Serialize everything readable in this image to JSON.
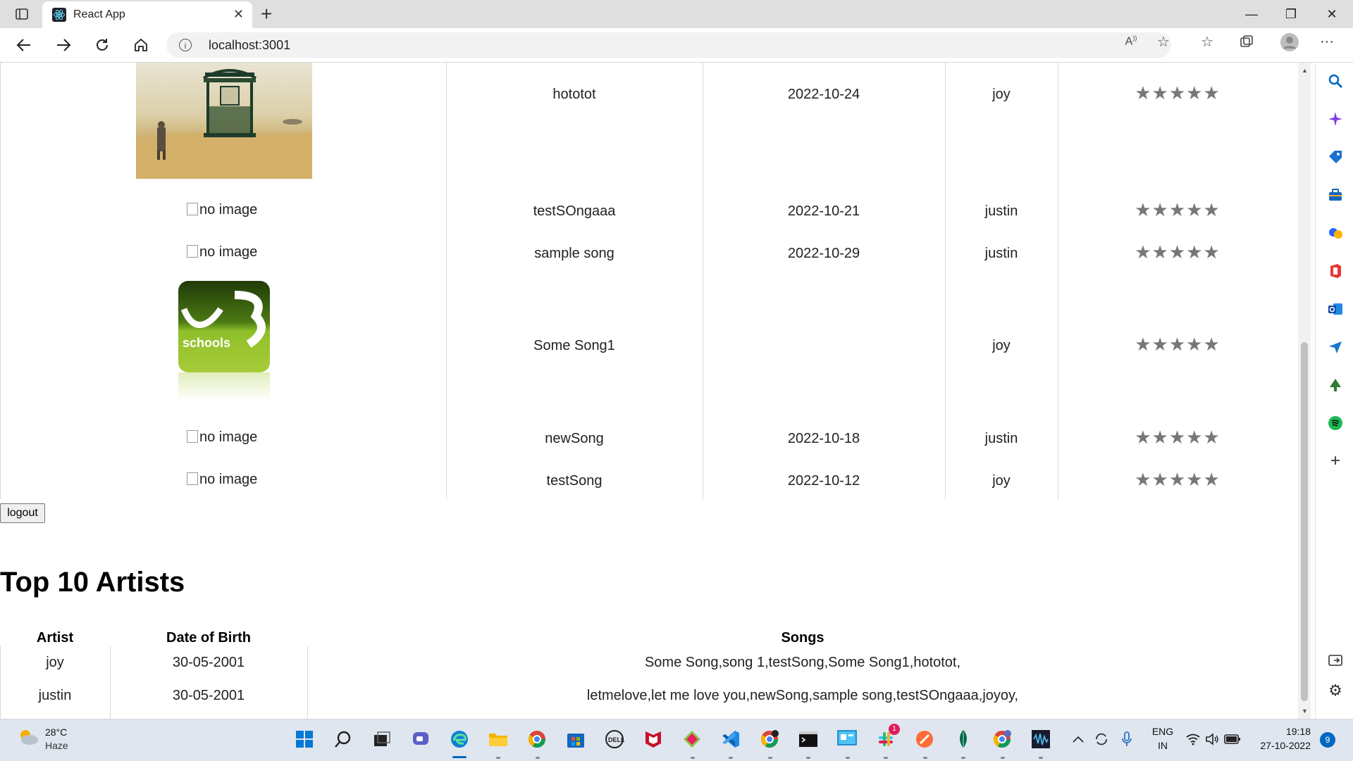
{
  "browser": {
    "tab_title": "React App",
    "url": "localhost:3001"
  },
  "songs": [
    {
      "cover": "album-photo",
      "name": "hototot",
      "date": "2022-10-24",
      "artist": "joy",
      "rating": "★★★★★"
    },
    {
      "cover": "no image",
      "name": "testSOngaaa",
      "date": "2022-10-21",
      "artist": "justin",
      "rating": "★★★★★"
    },
    {
      "cover": "no image",
      "name": "sample song",
      "date": "2022-10-29",
      "artist": "justin",
      "rating": "★★★★★"
    },
    {
      "cover": "w3schools-logo",
      "name": "Some Song1",
      "date": "",
      "artist": "joy",
      "rating": "★★★★★"
    },
    {
      "cover": "no image",
      "name": "newSong",
      "date": "2022-10-18",
      "artist": "justin",
      "rating": "★★★★★"
    },
    {
      "cover": "no image",
      "name": "testSong",
      "date": "2022-10-12",
      "artist": "joy",
      "rating": "★★★★★"
    }
  ],
  "logout_label": "logout",
  "top_artists": {
    "heading": "Top 10 Artists",
    "headers": [
      "Artist",
      "Date of Birth",
      "Songs"
    ],
    "rows": [
      {
        "artist": "joy",
        "dob": "30-05-2001",
        "songs": "Some Song,song 1,testSong,Some Song1,hototot,"
      },
      {
        "artist": "justin",
        "dob": "30-05-2001",
        "songs": "letmelove,let me love you,newSong,sample song,testSOngaaa,joyoy,"
      }
    ]
  },
  "w3_text": "schools",
  "taskbar": {
    "temp": "28°C",
    "condition": "Haze",
    "lang_top": "ENG",
    "lang_bottom": "IN",
    "time": "19:18",
    "date": "27-10-2022",
    "notifications": "9",
    "slack_badge": "1"
  },
  "colors": {
    "accent": "#0067c0",
    "star": "#777777",
    "taskbar_bg": "#dfe6ef"
  }
}
